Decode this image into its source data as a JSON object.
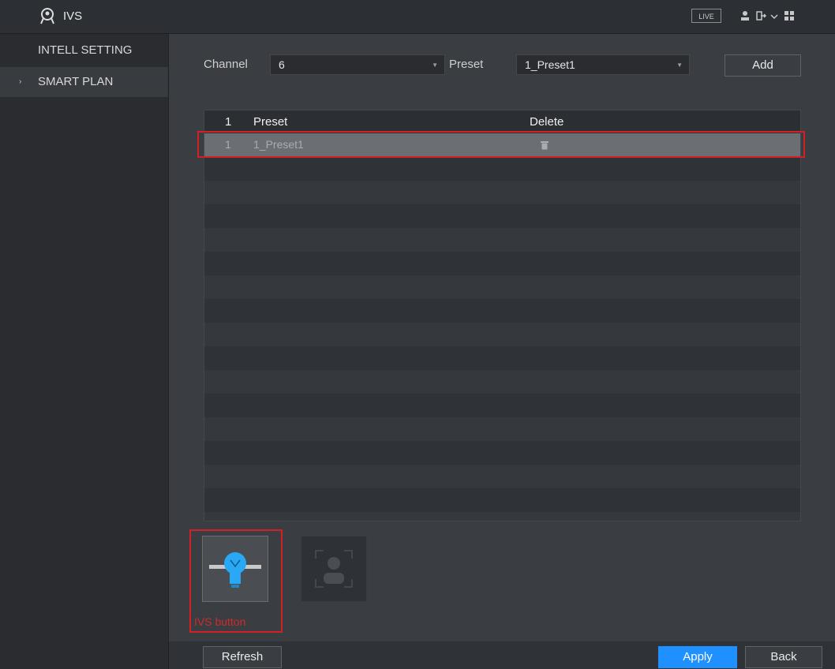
{
  "header": {
    "title": "IVS",
    "live_label": "LIVE"
  },
  "sidebar": {
    "items": [
      {
        "label": "INTELL SETTING",
        "active": false
      },
      {
        "label": "SMART PLAN",
        "active": true,
        "arrow": "›"
      }
    ]
  },
  "filters": {
    "channel_label": "Channel",
    "channel_value": "6",
    "preset_label": "Preset",
    "preset_value": "1_Preset1",
    "add_label": "Add"
  },
  "table": {
    "columns": [
      "1",
      "Preset",
      "Delete"
    ],
    "rows": [
      {
        "index": "1",
        "preset": "1_Preset1",
        "delete_icon": "trash-icon"
      }
    ]
  },
  "tiles": {
    "ivs_caption": "IVS button",
    "ivs_icon": "ivs-bulb-icon",
    "face_icon": "face-detection-icon"
  },
  "footer": {
    "refresh_label": "Refresh",
    "apply_label": "Apply",
    "back_label": "Back"
  },
  "colors": {
    "accent": "#1e90ff",
    "highlight": "#d41f26",
    "ivs_icon": "#29a9f5"
  }
}
